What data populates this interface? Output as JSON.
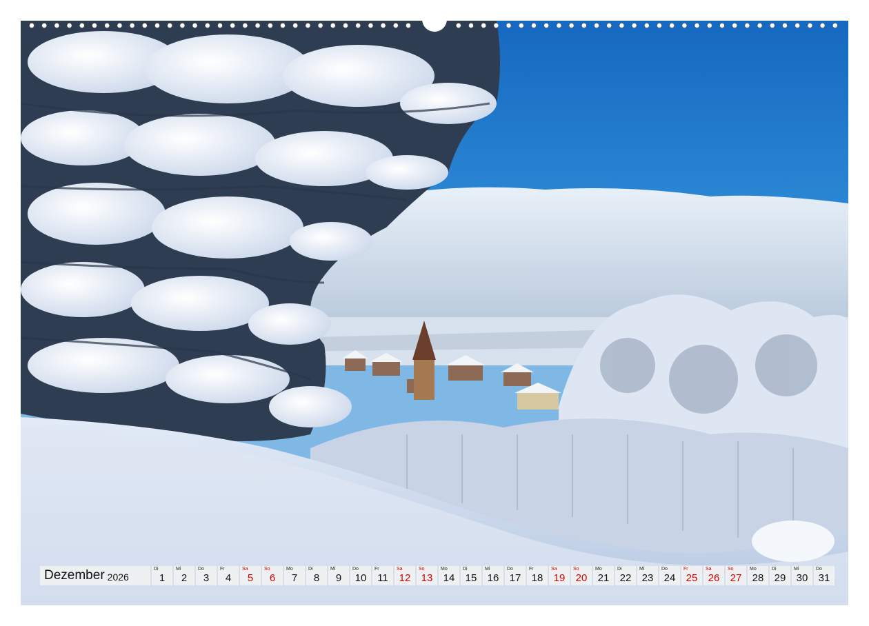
{
  "calendar": {
    "month": "Dezember",
    "year": "2026",
    "days": [
      {
        "wd": "Di",
        "d": "1",
        "weekend": false
      },
      {
        "wd": "Mi",
        "d": "2",
        "weekend": false
      },
      {
        "wd": "Do",
        "d": "3",
        "weekend": false
      },
      {
        "wd": "Fr",
        "d": "4",
        "weekend": false
      },
      {
        "wd": "Sa",
        "d": "5",
        "weekend": true
      },
      {
        "wd": "So",
        "d": "6",
        "weekend": true
      },
      {
        "wd": "Mo",
        "d": "7",
        "weekend": false
      },
      {
        "wd": "Di",
        "d": "8",
        "weekend": false
      },
      {
        "wd": "Mi",
        "d": "9",
        "weekend": false
      },
      {
        "wd": "Do",
        "d": "10",
        "weekend": false
      },
      {
        "wd": "Fr",
        "d": "11",
        "weekend": false
      },
      {
        "wd": "Sa",
        "d": "12",
        "weekend": true
      },
      {
        "wd": "So",
        "d": "13",
        "weekend": true
      },
      {
        "wd": "Mo",
        "d": "14",
        "weekend": false
      },
      {
        "wd": "Di",
        "d": "15",
        "weekend": false
      },
      {
        "wd": "Mi",
        "d": "16",
        "weekend": false
      },
      {
        "wd": "Do",
        "d": "17",
        "weekend": false
      },
      {
        "wd": "Fr",
        "d": "18",
        "weekend": false
      },
      {
        "wd": "Sa",
        "d": "19",
        "weekend": true
      },
      {
        "wd": "So",
        "d": "20",
        "weekend": true
      },
      {
        "wd": "Mo",
        "d": "21",
        "weekend": false
      },
      {
        "wd": "Di",
        "d": "22",
        "weekend": false
      },
      {
        "wd": "Mi",
        "d": "23",
        "weekend": false
      },
      {
        "wd": "Do",
        "d": "24",
        "weekend": false
      },
      {
        "wd": "Fr",
        "d": "25",
        "weekend": true
      },
      {
        "wd": "Sa",
        "d": "26",
        "weekend": true
      },
      {
        "wd": "So",
        "d": "27",
        "weekend": true
      },
      {
        "wd": "Mo",
        "d": "28",
        "weekend": false
      },
      {
        "wd": "Di",
        "d": "29",
        "weekend": false
      },
      {
        "wd": "Mi",
        "d": "30",
        "weekend": false
      },
      {
        "wd": "Do",
        "d": "31",
        "weekend": false
      }
    ]
  },
  "colors": {
    "sky_top": "#1a78c8",
    "sky_bottom": "#5aa6dc",
    "snow": "#eef3fb",
    "weekend_red": "#d40000"
  }
}
